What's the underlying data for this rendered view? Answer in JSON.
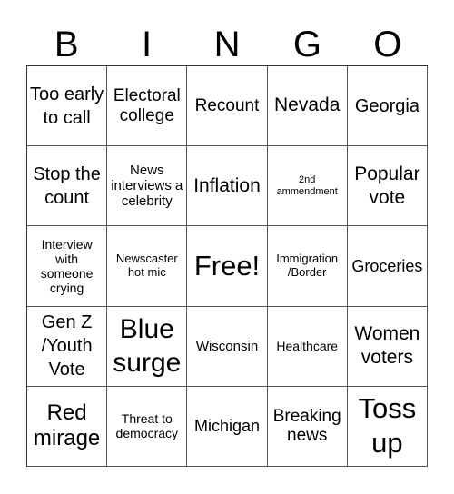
{
  "header": [
    "B",
    "I",
    "N",
    "G",
    "O"
  ],
  "cells": [
    [
      "Too early to call",
      "Electoral college",
      "Recount",
      "Nevada",
      "Georgia"
    ],
    [
      "Stop the count",
      "News interviews a celebrity",
      "Inflation",
      "2nd ammendment",
      "Popular vote"
    ],
    [
      "Interview with someone crying",
      "Newscaster hot mic",
      "Free!",
      "Immigration /Border",
      "Groceries"
    ],
    [
      "Gen Z /Youth Vote",
      "Blue surge",
      "Wisconsin",
      "Healthcare",
      "Women voters"
    ],
    [
      "Red mirage",
      "Threat to democracy",
      "Michigan",
      "Breaking news",
      "Toss up"
    ]
  ]
}
